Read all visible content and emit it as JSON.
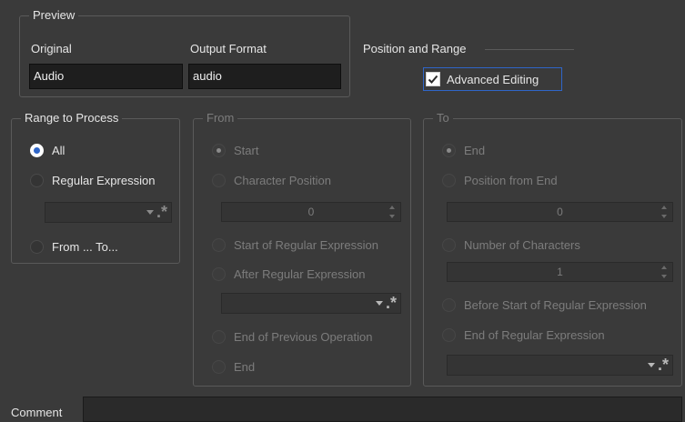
{
  "preview": {
    "title": "Preview",
    "original_label": "Original",
    "original_value": "Audio",
    "output_label": "Output Format",
    "output_value": "audio"
  },
  "position": {
    "title": "Position and Range",
    "advanced_label": "Advanced Editing",
    "advanced_checked": true
  },
  "range": {
    "title": "Range to Process",
    "all": "All",
    "regex": "Regular Expression",
    "from_to": "From ... To..."
  },
  "from": {
    "title": "From",
    "start": "Start",
    "char_pos": "Character Position",
    "char_pos_value": "0",
    "start_regex": "Start of Regular Expression",
    "after_regex": "After Regular Expression",
    "end_prev": "End of Previous Operation",
    "end": "End"
  },
  "to": {
    "title": "To",
    "end": "End",
    "pos_from_end": "Position from End",
    "pos_from_end_value": "0",
    "num_chars": "Number of Characters",
    "num_chars_value": "1",
    "before_start_regex": "Before Start of Regular Expression",
    "end_regex": "End of Regular Expression"
  },
  "comment": {
    "label": "Comment",
    "value": ""
  }
}
